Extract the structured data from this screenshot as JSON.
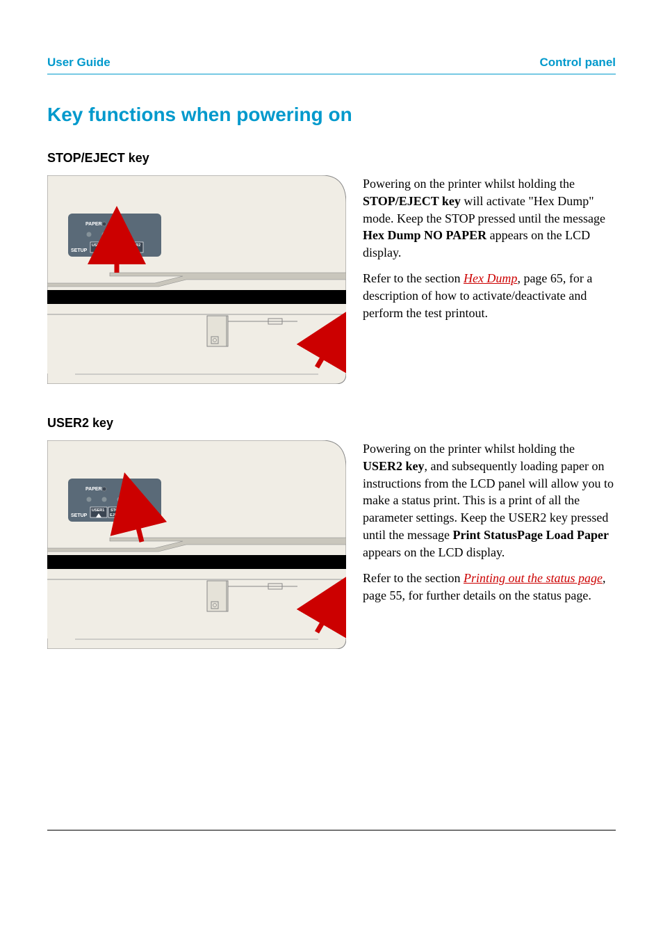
{
  "header": {
    "left": "User Guide",
    "right": "Control panel"
  },
  "title": "Key functions when powering on",
  "section1": {
    "heading": "STOP/EJECT key",
    "p1_a": "Powering on the printer whilst holding the ",
    "p1_b": "STOP/EJECT key",
    "p1_c": " will activate \"Hex Dump\" mode. Keep the STOP pressed until the message ",
    "p1_d": "Hex Dump NO PAPER",
    "p1_e": " appears on the LCD display.",
    "p2_a": "Refer to the section ",
    "p2_link": "Hex Dump",
    "p2_b": ", page 65, for a description of how to activate/deactivate and perform the test printout."
  },
  "section2": {
    "heading": "USER2 key",
    "p1_a": "Powering on the printer whilst holding the ",
    "p1_b": "USER2 key",
    "p1_c": ", and subsequently loading paper on instructions from the LCD panel will allow you to make a status print.  This is a print of all the parameter settings. Keep the USER2 key pressed until the message ",
    "p1_d": "Print StatusPage Load Paper",
    "p1_e": " appears on the LCD display.",
    "p2_a": "Refer to the section ",
    "p2_link": "Printing out the status page",
    "p2_b": ", page 55, for further details on the status page."
  },
  "panel": {
    "paper": "PAPER",
    "setup": "SETUP",
    "user1": "USER1",
    "stop": "STOP",
    "eject": "EJECT",
    "user2": "USER2"
  }
}
